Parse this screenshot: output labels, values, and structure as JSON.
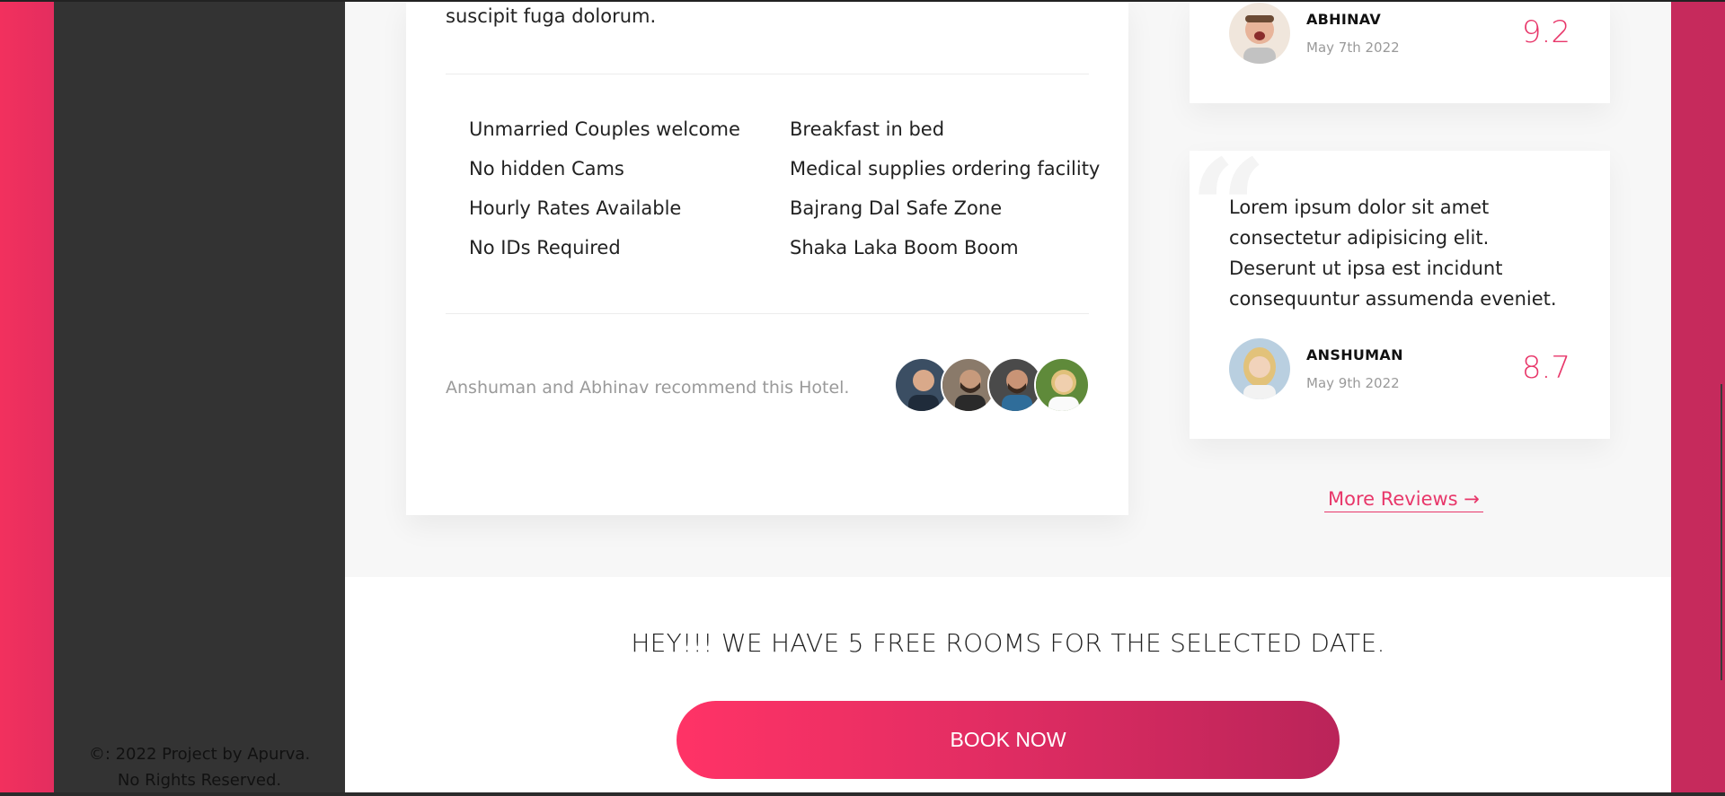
{
  "sidebar": {
    "copyright_line1": "©: 2022 Project by Apurva.",
    "copyright_line2": "No Rights Reserved."
  },
  "hotel": {
    "intro_text_tail": "suscipit fuga dolorum.",
    "amenities_left": [
      "Unmarried Couples welcome",
      "No hidden Cams",
      "Hourly Rates Available",
      "No IDs Required"
    ],
    "amenities_right": [
      "Breakfast in bed",
      "Medical supplies ordering facility",
      "Bajrang Dal Safe Zone",
      "Shaka Laka Boom Boom"
    ],
    "recommend_text": "Anshuman and Abhinav recommend this Hotel."
  },
  "reviews": [
    {
      "name": "ABHINAV",
      "date": "May 7th 2022",
      "score": "9.2",
      "body": ""
    },
    {
      "name": "ANSHUMAN",
      "date": "May 9th 2022",
      "score": "8.7",
      "body": "Lorem ipsum dolor sit amet consectetur adipisicing elit. Deserunt ut ipsa est incidunt consequuntur assumenda eveniet."
    }
  ],
  "more_reviews_label": "More Reviews →",
  "cta": {
    "message": "HEY!!! WE HAVE 5 FREE ROOMS FOR THE SELECTED DATE.",
    "button_label": "BOOK NOW"
  },
  "colors": {
    "accent": "#e8376a",
    "sidebar_bg": "#333333",
    "frame_pink": "#e42e5f"
  }
}
